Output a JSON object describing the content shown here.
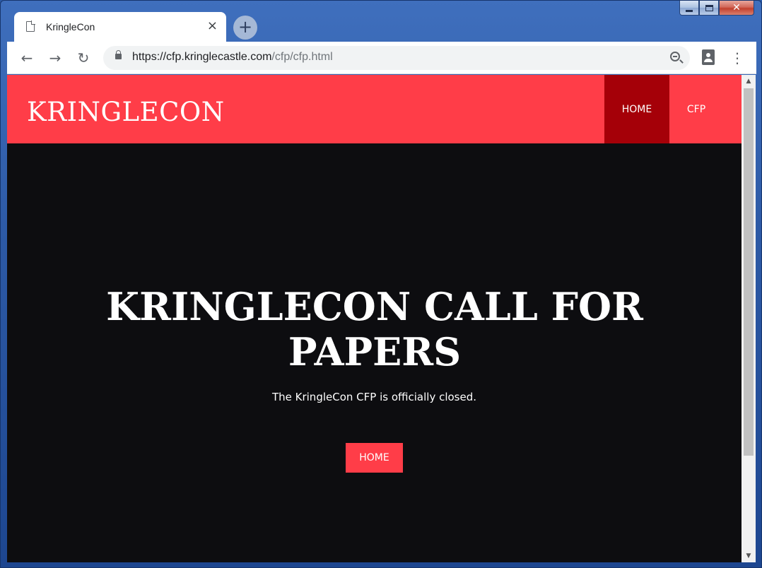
{
  "browser": {
    "tab_title": "KringleCon",
    "tab_close": "×",
    "new_tab": "+",
    "url_host": "https://cfp.kringlecastle.com",
    "url_path": "/cfp/cfp.html",
    "back": "←",
    "forward": "→",
    "reload": "↻",
    "menu": "⋮",
    "icons": [
      "document-icon",
      "lock-icon",
      "zoom-icon",
      "extension-icon",
      "menu-icon"
    ]
  },
  "window": {
    "close": "✕"
  },
  "site": {
    "brand": "KRINGLECON",
    "nav": [
      "HOME",
      "CFP"
    ],
    "hero_title": "KRINGLECON CALL FOR PAPERS",
    "hero_subtitle": "The KringleCon CFP is officially closed.",
    "cta_label": "HOME",
    "colors": {
      "accent": "#ff3d48",
      "nav_active": "#a50008",
      "background": "#0d0d10"
    }
  }
}
